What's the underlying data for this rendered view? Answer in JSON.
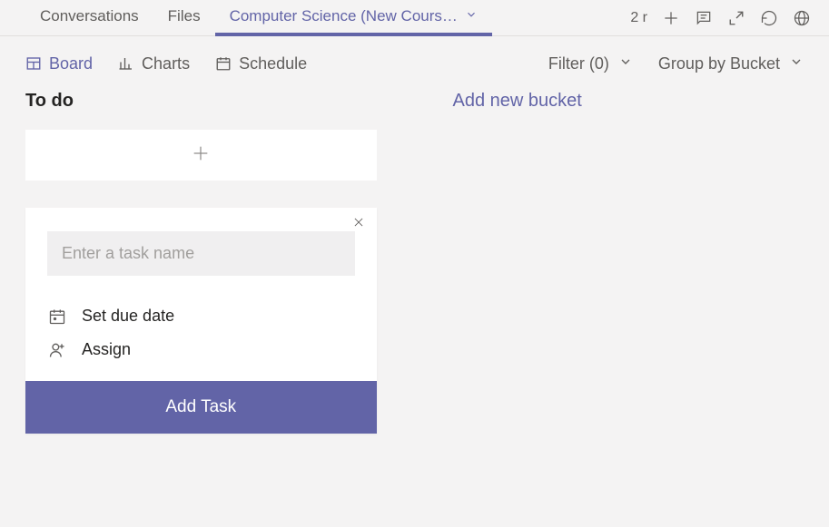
{
  "topbar": {
    "tabs": {
      "conversations": "Conversations",
      "files": "Files",
      "planner": "Computer Science (New Cours…"
    },
    "meeting_count": "2 r"
  },
  "viewbar": {
    "board": "Board",
    "charts": "Charts",
    "schedule": "Schedule",
    "filter": "Filter (0)",
    "group_by": "Group by Bucket"
  },
  "board": {
    "bucket_todo": "To do",
    "add_new_bucket": "Add new bucket",
    "task_form": {
      "placeholder": "Enter a task name",
      "value": "",
      "due_date": "Set due date",
      "assign": "Assign",
      "submit": "Add Task"
    }
  }
}
